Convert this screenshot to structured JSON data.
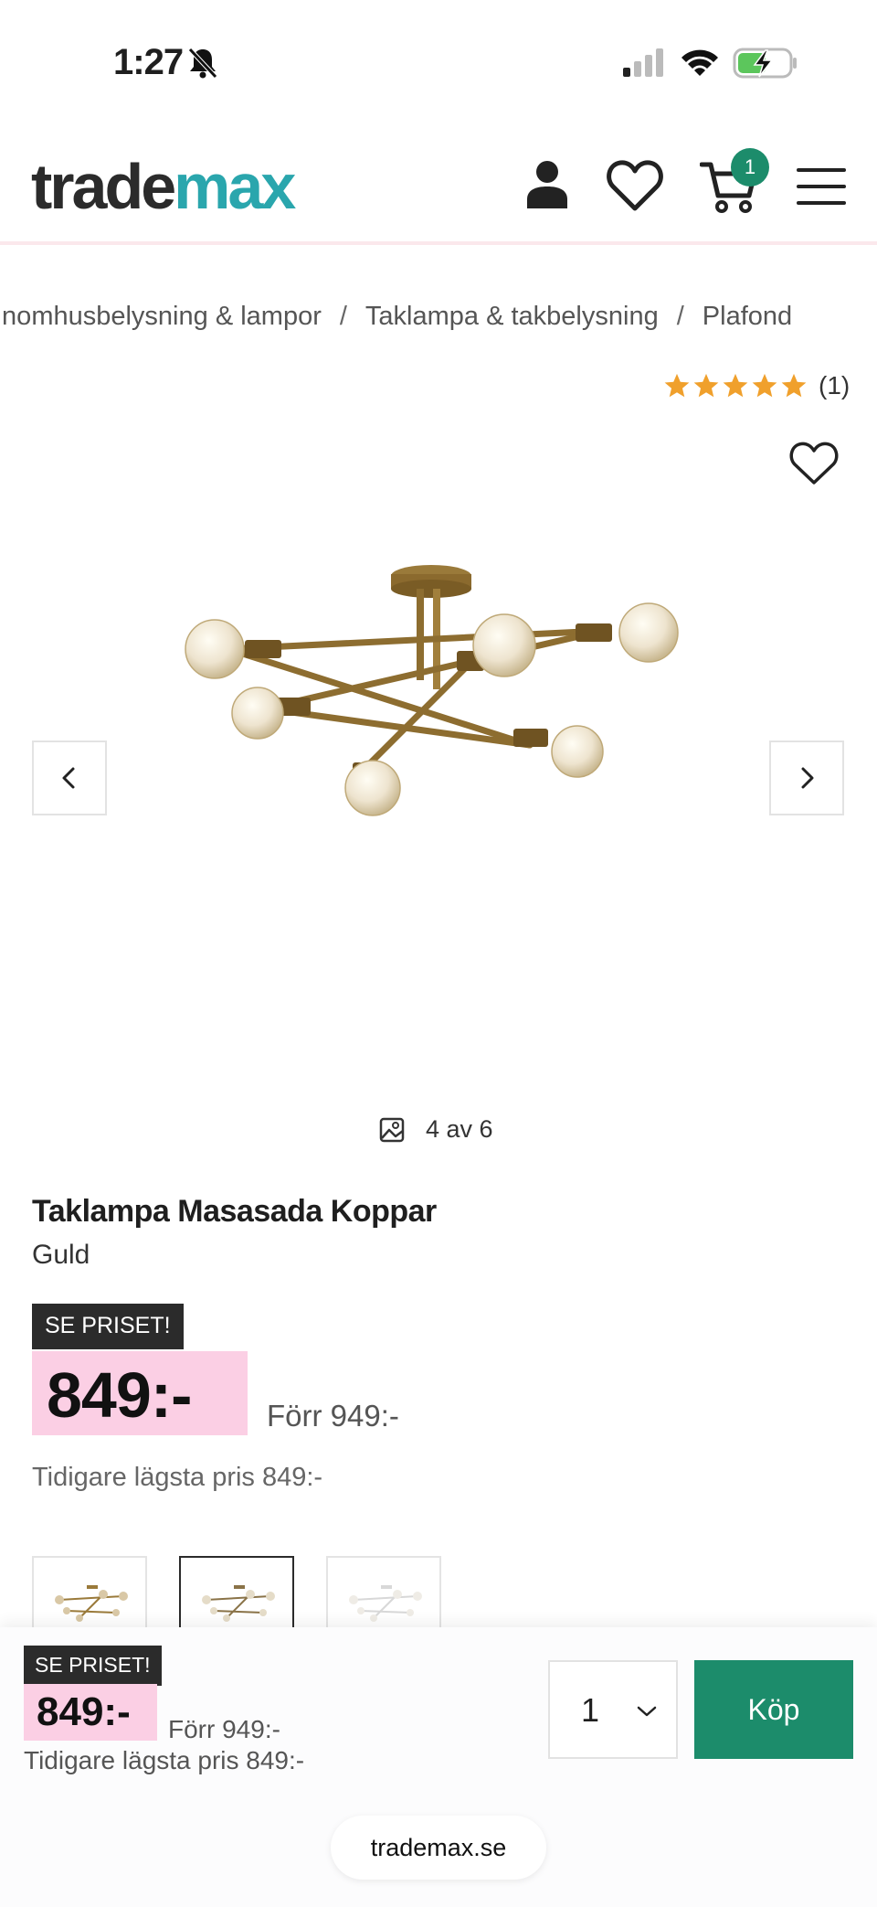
{
  "status_bar": {
    "time": "1:27"
  },
  "header": {
    "logo_part_a": "trade",
    "logo_part_b": "max",
    "cart_count": "1",
    "icons": [
      "account-icon",
      "heart-icon",
      "cart-icon",
      "menu-icon"
    ]
  },
  "breadcrumb": {
    "items": [
      "Inomhusbelysning & lampor",
      "Taklampa & takbelysning",
      "Plafond"
    ],
    "separator": "/"
  },
  "rating": {
    "stars": 5,
    "count": "(1)"
  },
  "gallery": {
    "counter": "4 av 6",
    "current": 4,
    "total": 6
  },
  "product": {
    "title": "Taklampa Masasada Koppar",
    "variant": "Guld",
    "promo_tag": "SE PRISET!",
    "price": "849:-",
    "old_price": "Förr 949:-",
    "lowest_price": "Tidigare lägsta pris 849:-"
  },
  "sticky_bar": {
    "promo_tag": "SE PRISET!",
    "price": "849:-",
    "old_price": "Förr 949:-",
    "lowest_price": "Tidigare lägsta pris 849:-",
    "quantity": "1",
    "buy_label": "Köp"
  },
  "browser": {
    "url": "trademax.se"
  },
  "colors": {
    "accent_green": "#1c8c6b",
    "logo_teal": "#2aa6ad",
    "price_bg": "#fbcfe4",
    "star": "#f0a02c"
  }
}
